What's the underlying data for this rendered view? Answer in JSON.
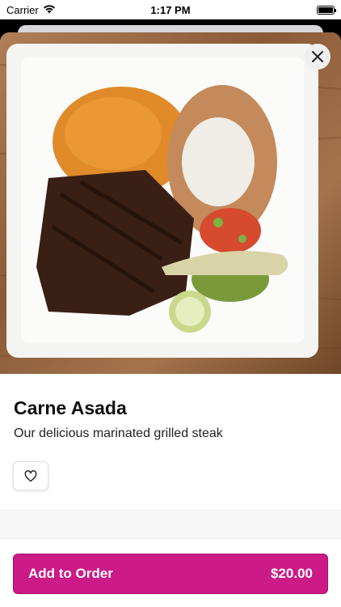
{
  "status_bar": {
    "carrier": "Carrier",
    "time": "1:17 PM",
    "icons": [
      "wifi-icon",
      "battery-icon"
    ]
  },
  "item": {
    "image_alt": "plate-of-carne-asada-photo",
    "title": "Carne Asada",
    "description": "Our delicious marinated grilled steak"
  },
  "actions": {
    "close_icon": "close-icon",
    "favorite_icon": "heart-icon",
    "add_label": "Add to Order",
    "price": "$20.00"
  },
  "colors": {
    "accent": "#cc1a86"
  }
}
